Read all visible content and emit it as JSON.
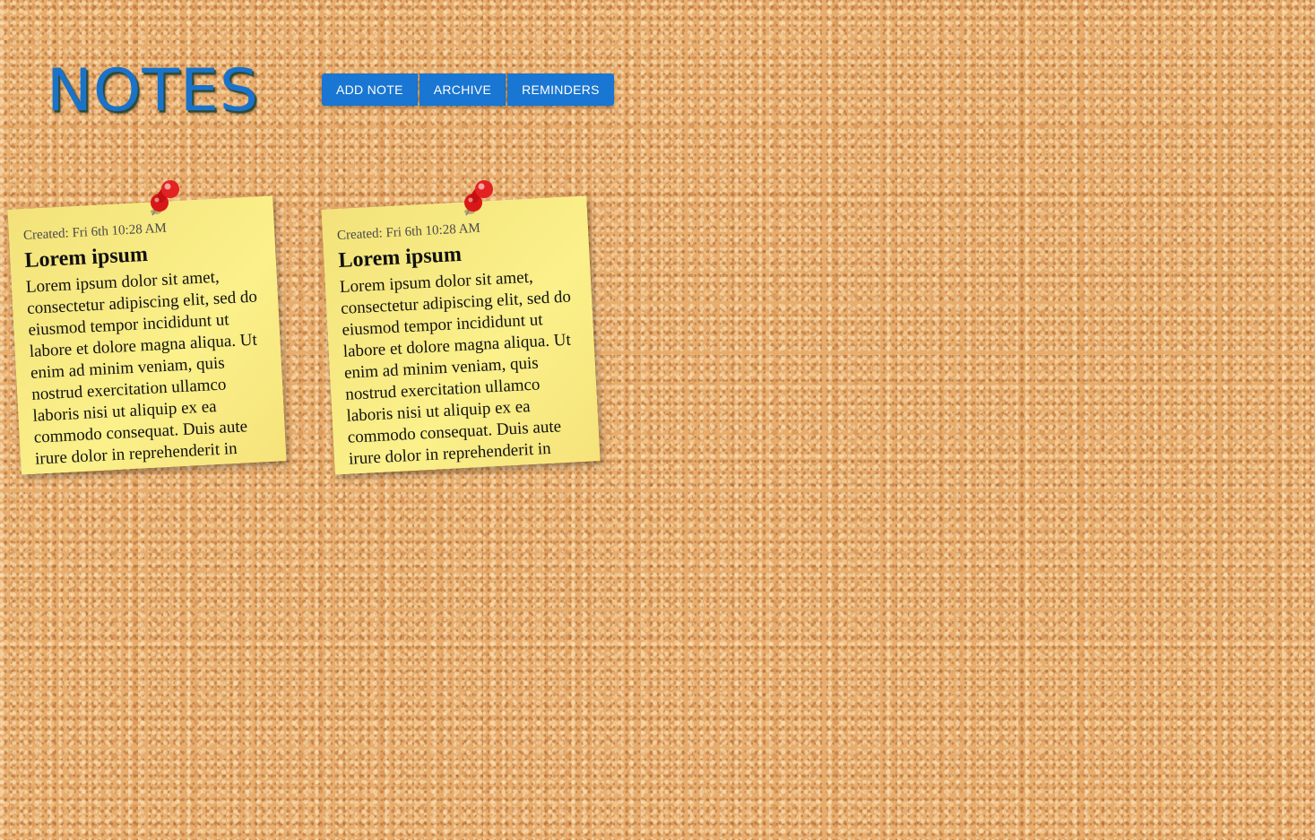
{
  "app": {
    "title": "NOTES"
  },
  "toolbar": {
    "add_note_label": "ADD NOTE",
    "archive_label": "ARCHIVE",
    "reminders_label": "REMINDERS"
  },
  "notes": [
    {
      "created": "Created: Fri 6th 10:28 AM",
      "title": "Lorem ipsum",
      "body": "Lorem ipsum dolor sit amet, consectetur adipiscing elit, sed do eiusmod tempor incididunt ut labore et dolore magna aliqua. Ut enim ad minim veniam, quis nostrud exercitation ullamco laboris nisi ut aliquip ex ea commodo consequat. Duis aute irure dolor in reprehenderit in"
    },
    {
      "created": "Created: Fri 6th 10:28 AM",
      "title": "Lorem ipsum",
      "body": "Lorem ipsum dolor sit amet, consectetur adipiscing elit, sed do eiusmod tempor incididunt ut labore et dolore magna aliqua. Ut enim ad minim veniam, quis nostrud exercitation ullamco laboris nisi ut aliquip ex ea commodo consequat. Duis aute irure dolor in reprehenderit in"
    }
  ],
  "icons": {
    "pin": "pushpin-icon"
  },
  "colors": {
    "accent": "#1976d2",
    "title": "#1a72c9",
    "note": "#f9ec85",
    "pin": "#e02020",
    "background": "#e8ad6c"
  }
}
